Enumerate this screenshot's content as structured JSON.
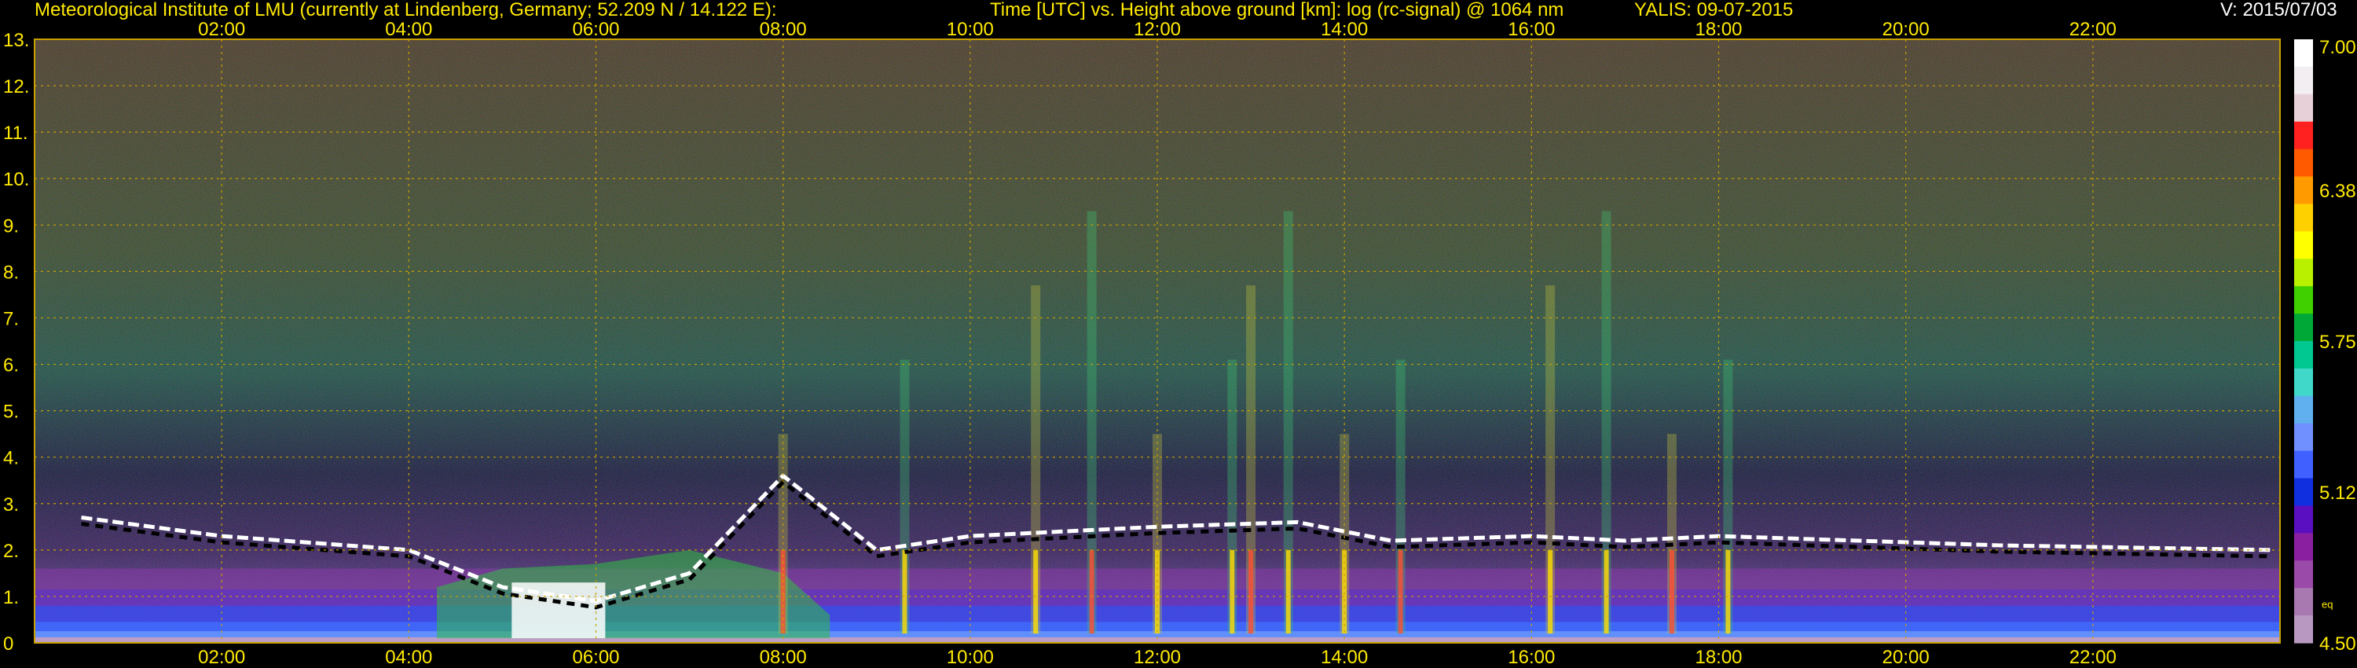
{
  "header": {
    "institute": "Meteorological Institute of LMU (currently at Lindenberg, Germany; 52.209 N / 14.122 E):",
    "axes_title": "Time [UTC] vs. Height above ground [km]: log (rc-signal) @ 1064 nm",
    "instrument_date": "YALIS: 09-07-2015",
    "version": "V: 2015/07/03"
  },
  "chart_data": {
    "type": "heatmap",
    "title": "Time [UTC] vs. Height above ground [km]: log (rc-signal) @ 1064 nm",
    "x_ticks": [
      "02:00",
      "04:00",
      "06:00",
      "08:00",
      "10:00",
      "12:00",
      "14:00",
      "16:00",
      "18:00",
      "20:00",
      "22:00"
    ],
    "x_tick_hours": [
      2,
      4,
      6,
      8,
      10,
      12,
      14,
      16,
      18,
      20,
      22
    ],
    "xlim_hours": [
      0.0,
      24.0
    ],
    "y_ticks": [
      "0",
      "1.",
      "2.",
      "3.",
      "4.",
      "5.",
      "6.",
      "7.",
      "8.",
      "9.",
      "10.",
      "11.",
      "12.",
      "13."
    ],
    "ylim_km": [
      0,
      13
    ],
    "grid": true,
    "colorbar": {
      "labels": [
        "7.00",
        "6.38",
        "5.75",
        "5.12",
        "4.50"
      ],
      "sub_label": "eq",
      "range": [
        4.5,
        7.0
      ],
      "colors": [
        "#ffffff",
        "#f2eef2",
        "#e8d0d8",
        "#ff2020",
        "#ff5a00",
        "#ff9a00",
        "#ffd000",
        "#ffff00",
        "#b8f000",
        "#40d000",
        "#00a838",
        "#00c890",
        "#40d8c8",
        "#60b0f0",
        "#7090ff",
        "#4060ff",
        "#1030e0",
        "#5a10c0",
        "#8a20a0",
        "#9a4aa8",
        "#a878b0",
        "#b898c0"
      ]
    },
    "features": {
      "boundary_layer_top_km": [
        [
          0.5,
          2.7
        ],
        [
          2.0,
          2.3
        ],
        [
          4.0,
          2.0
        ],
        [
          5.0,
          1.2
        ],
        [
          6.0,
          0.9
        ],
        [
          7.0,
          1.5
        ],
        [
          8.0,
          3.6
        ],
        [
          9.0,
          2.0
        ],
        [
          10.0,
          2.3
        ],
        [
          11.0,
          2.4
        ],
        [
          12.0,
          2.5
        ],
        [
          13.5,
          2.6
        ],
        [
          14.5,
          2.2
        ],
        [
          16.0,
          2.3
        ],
        [
          17.0,
          2.2
        ],
        [
          18.0,
          2.3
        ],
        [
          19.5,
          2.2
        ],
        [
          21.0,
          2.1
        ],
        [
          23.9,
          2.0
        ]
      ]
    }
  }
}
